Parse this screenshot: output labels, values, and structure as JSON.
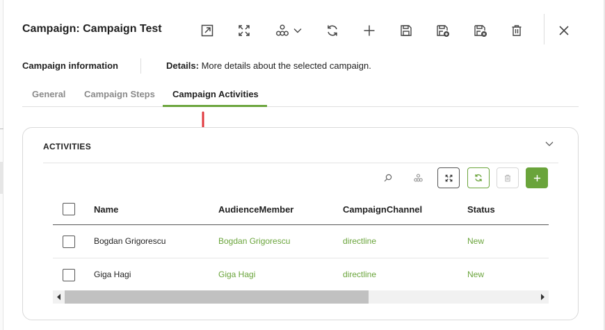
{
  "header": {
    "title": "Campaign: Campaign Test"
  },
  "toolbar": {
    "icons": [
      "open-in-new-icon",
      "expand-icon",
      "workflow-icon",
      "chevron-down-icon",
      "refresh-icon",
      "add-icon",
      "save-icon",
      "save-new-icon",
      "save-close-icon",
      "delete-icon",
      "close-icon"
    ]
  },
  "info": {
    "label": "Campaign information",
    "details_prefix": "Details:",
    "details_text": " More details about the selected campaign."
  },
  "tabs": [
    {
      "label": "General",
      "active": false
    },
    {
      "label": "Campaign Steps",
      "active": false
    },
    {
      "label": "Campaign Activities",
      "active": true
    }
  ],
  "activities": {
    "title": "ACTIVITIES",
    "columns": [
      "Name",
      "AudienceMember",
      "CampaignChannel",
      "Status"
    ],
    "rows": [
      {
        "name": "Bogdan Grigorescu",
        "audience_member": "Bogdan Grigorescu",
        "channel": "directline",
        "status": "New"
      },
      {
        "name": "Giga Hagi",
        "audience_member": "Giga Hagi",
        "channel": "directline",
        "status": "New"
      }
    ]
  },
  "colors": {
    "accent": "#6aa43b",
    "annotation_arrow": "#e0383e",
    "text": "#1f1f1f",
    "muted": "#8a8a8a"
  }
}
